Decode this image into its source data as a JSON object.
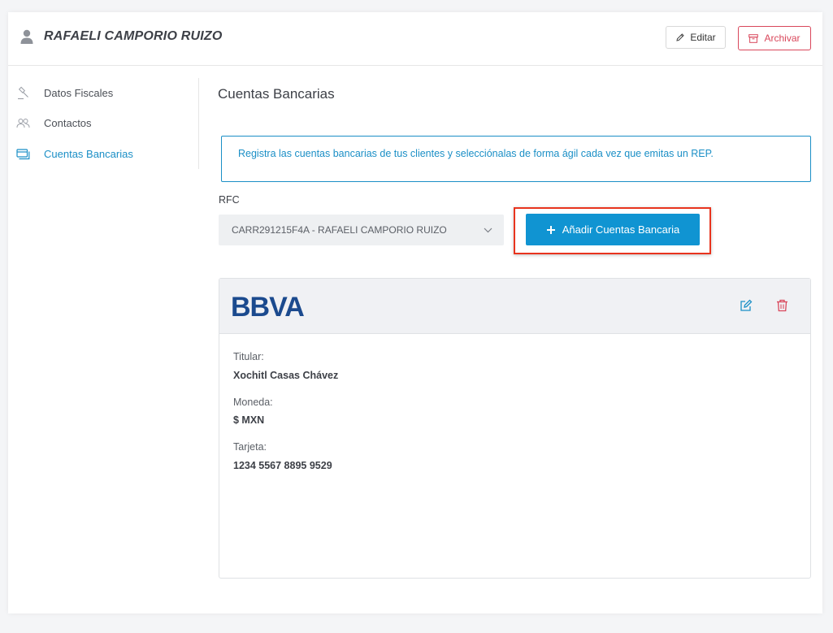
{
  "header": {
    "client_name": "RAFAELI CAMPORIO RUIZO",
    "edit_label": "Editar",
    "archive_label": "Archivar"
  },
  "sidebar": {
    "items": [
      {
        "label": "Datos Fiscales",
        "icon": "gavel-icon",
        "active": false
      },
      {
        "label": "Contactos",
        "icon": "users-icon",
        "active": false
      },
      {
        "label": "Cuentas Bancarias",
        "icon": "cards-icon",
        "active": true
      }
    ]
  },
  "main": {
    "section_title": "Cuentas Bancarias",
    "info_text": "Registra las cuentas bancarias de tus clientes y selecciónalas de forma ágil cada vez que emitas un REP.",
    "rfc_label": "RFC",
    "rfc_value": "CARR291215F4A - RAFAELI CAMPORIO RUIZO",
    "add_button_label": "Añadir Cuentas Bancaria"
  },
  "bank_account": {
    "bank_name": "BBVA",
    "titular_label": "Titular:",
    "titular_value": "Xochitl Casas Chávez",
    "moneda_label": "Moneda:",
    "moneda_value": "$ MXN",
    "tarjeta_label": "Tarjeta:",
    "tarjeta_value": "1234 5567 8895 9529"
  },
  "colors": {
    "accent": "#1094d2",
    "danger": "#d9475b",
    "bank_brand": "#1b4a8e",
    "highlight": "#e8341e"
  }
}
